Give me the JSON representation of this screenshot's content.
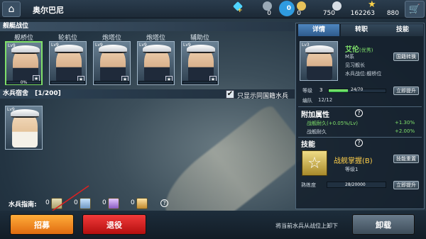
{
  "header": {
    "home_icon": "home-icon",
    "title": "奥尔巴尼",
    "cart_icon": "cart-icon",
    "resources": [
      {
        "name": "diamond",
        "icon": "diamond-icon",
        "color": "#4fd4ff",
        "value": "0"
      },
      {
        "name": "fuel",
        "icon": "fuel-icon",
        "color": "#9aa9b6",
        "value": "0"
      },
      {
        "name": "oil",
        "icon": "oil-drop-icon",
        "color": "#2f9be0",
        "value": "0"
      },
      {
        "name": "coin",
        "icon": "coin-icon",
        "color": "#e8c25a",
        "value": "750"
      },
      {
        "name": "silver",
        "icon": "silver-coin-icon",
        "color": "#d6dde4",
        "value": "162263"
      },
      {
        "name": "star",
        "icon": "star-icon",
        "color": "#ffd34a",
        "value": "880"
      }
    ]
  },
  "battle": {
    "section_title": "舰艇战位",
    "positions": [
      {
        "label": "舰桥位",
        "level": "Lv9",
        "progress": "0%",
        "progress_value": 0
      },
      {
        "label": "轮机位",
        "level": "Lv9",
        "progress": "",
        "progress_value": 0
      },
      {
        "label": "炮塔位",
        "level": "Lv9",
        "progress": "",
        "progress_value": 0
      },
      {
        "label": "炮塔位",
        "level": "Lv9",
        "progress": "",
        "progress_value": 0
      },
      {
        "label": "辅助位",
        "level": "Lv9",
        "progress": "",
        "progress_value": 0
      }
    ]
  },
  "dorm": {
    "title": "水兵宿舍",
    "count": "[1/200]",
    "level": "Lv9",
    "filter_label": "只显示同国籍水兵",
    "filter_checked": true
  },
  "guide": {
    "label": "水兵指南:",
    "items": [
      "0",
      "0",
      "0",
      "0"
    ],
    "help": "?"
  },
  "buttons": {
    "recruit": "招募",
    "retire": "退役",
    "unload_hint": "将当前水兵从战位上卸下",
    "unload": "卸载"
  },
  "panel": {
    "tabs": [
      "详情",
      "转职",
      "技能"
    ],
    "sailor": {
      "level": "Lv3",
      "name": "艾伦",
      "quality": "(优秀)",
      "country": "M系",
      "rank": "见习舰长",
      "post_label": "水兵战位:",
      "post": "舰桥位",
      "reset_btn": "国籍转换"
    },
    "stats": {
      "grade_label": "等级",
      "grade": "3",
      "exp": "24/70",
      "exp_value": 0.34,
      "upgrade_btn": "立即提升",
      "crew_label": "编队",
      "crew": "12/12"
    },
    "attr_title": "附加属性",
    "help": "?",
    "attrs": [
      {
        "label": "战舰耐久(+0.05%/Lv)",
        "value": "+1.30%"
      },
      {
        "label": "战舰耐久",
        "value": "+2.00%"
      }
    ],
    "skill_title": "技能",
    "skill": {
      "name": "战舰掌握(B)",
      "level": "等级1",
      "reset_btn": "技能重置"
    },
    "mastery": {
      "label": "熟练度",
      "value": "28/20000",
      "btn": "立即提升"
    }
  }
}
